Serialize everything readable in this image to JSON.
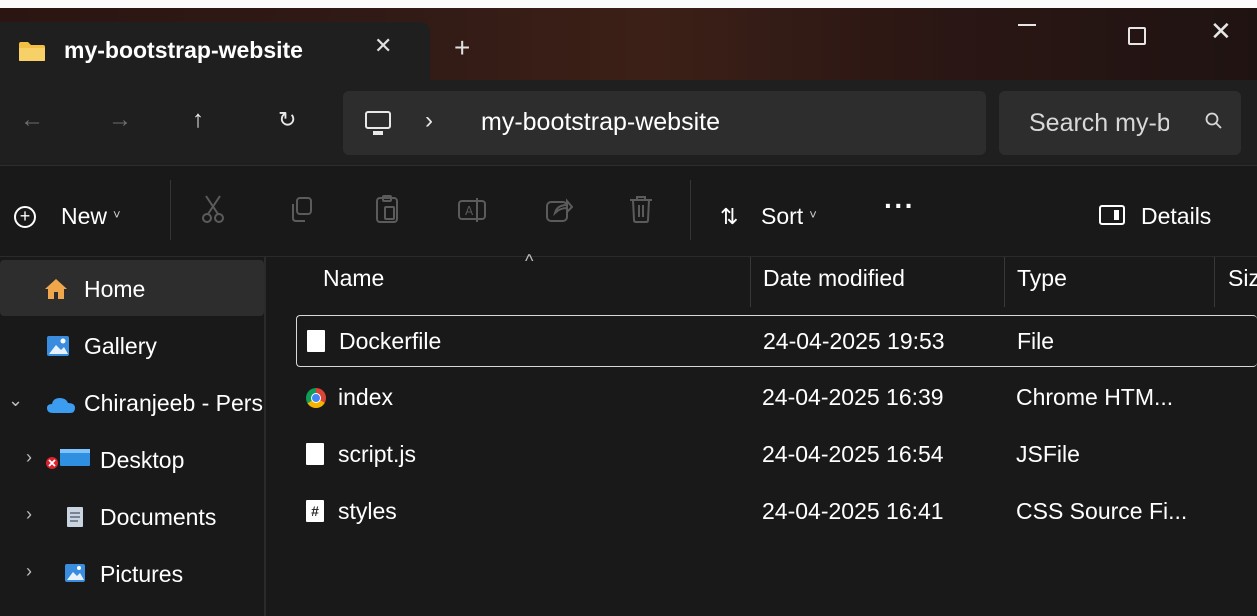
{
  "window": {
    "tab_title": "my-bootstrap-website",
    "tab_close": "✕",
    "new_tab": "+",
    "close_glyph": "✕"
  },
  "nav": {
    "back": "←",
    "forward": "→",
    "up": "↑",
    "refresh": "↻",
    "breadcrumb_separator": "›",
    "path_current": "my-bootstrap-website",
    "search_placeholder": "Search my-bootstrap-website"
  },
  "commands": {
    "new_label": "New",
    "sort_label": "Sort",
    "more_label": "···",
    "details_label": "Details",
    "caret": "˅"
  },
  "sidebar": {
    "items": [
      {
        "label": "Home",
        "icon": "home-icon",
        "active": true
      },
      {
        "label": "Gallery",
        "icon": "gallery-icon"
      },
      {
        "label": "Chiranjeeb - Personal",
        "icon": "onedrive-icon",
        "expanded": true
      },
      {
        "label": "Desktop",
        "icon": "desktop-icon",
        "status": "sync-error"
      },
      {
        "label": "Documents",
        "icon": "documents-icon"
      },
      {
        "label": "Pictures",
        "icon": "pictures-icon"
      }
    ]
  },
  "list": {
    "columns": [
      "Name",
      "Date modified",
      "Type",
      "Size"
    ],
    "rows": [
      {
        "name": "Dockerfile",
        "date": "24-04-2025 19:53",
        "type": "File",
        "icon": "file-icon",
        "selected": true
      },
      {
        "name": "index",
        "date": "24-04-2025 16:39",
        "type": "Chrome HTM...",
        "icon": "chrome-html-icon"
      },
      {
        "name": "script.js",
        "date": "24-04-2025 16:54",
        "type": "JSFile",
        "icon": "file-icon"
      },
      {
        "name": "styles",
        "date": "24-04-2025 16:41",
        "type": "CSS Source Fi...",
        "icon": "css-file-icon"
      }
    ]
  },
  "colors": {
    "background": "#191919",
    "title_gradient_mid": "#3c2017",
    "address_bg": "#2d2d2d",
    "selection_border": "#d8d8d8",
    "home_icon": "#f0a64a",
    "onedrive_icon": "#3b9cf0"
  }
}
